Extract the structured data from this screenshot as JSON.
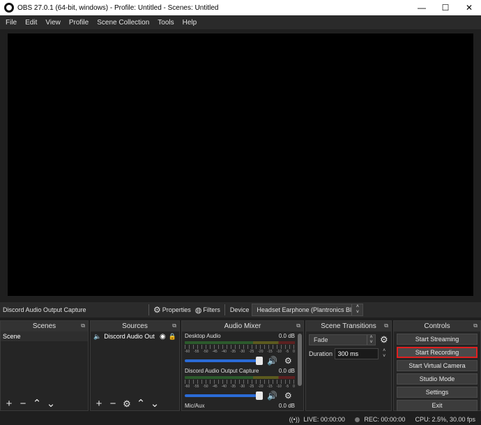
{
  "window": {
    "title": "OBS 27.0.1 (64-bit, windows) - Profile: Untitled - Scenes: Untitled",
    "minimize_glyph": "—",
    "maximize_glyph": "☐",
    "close_glyph": "✕"
  },
  "menu": [
    "File",
    "Edit",
    "View",
    "Profile",
    "Scene Collection",
    "Tools",
    "Help"
  ],
  "context_bar": {
    "source_name": "Discord Audio Output Capture",
    "properties_label": "Properties",
    "filters_label": "Filters",
    "device_label": "Device",
    "device_value": "Headset Earphone (Plantronics Blac"
  },
  "docks": {
    "scenes": {
      "title": "Scenes",
      "items": [
        "Scene"
      ]
    },
    "sources": {
      "title": "Sources",
      "items": [
        "Discord Audio Out"
      ]
    },
    "mixer": {
      "title": "Audio Mixer",
      "tracks": [
        {
          "name": "Desktop Audio",
          "db": "0.0 dB",
          "volume": 1.0
        },
        {
          "name": "Discord Audio Output Capture",
          "db": "0.0 dB",
          "volume": 1.0
        },
        {
          "name": "Mic/Aux",
          "db": "0.0 dB"
        }
      ],
      "tick_labels": [
        "-60",
        "-55",
        "-50",
        "-45",
        "-40",
        "-35",
        "-30",
        "-25",
        "-20",
        "-15",
        "-10",
        "-5",
        "0"
      ]
    },
    "transitions": {
      "title": "Scene Transitions",
      "transition": "Fade",
      "duration_label": "Duration",
      "duration_value": "300 ms"
    },
    "controls": {
      "title": "Controls",
      "buttons": [
        "Start Streaming",
        "Start Recording",
        "Start Virtual Camera",
        "Studio Mode",
        "Settings",
        "Exit"
      ]
    }
  },
  "status": {
    "live": "LIVE: 00:00:00",
    "rec": "REC: 00:00:00",
    "cpu": "CPU: 2.5%, 30.00 fps"
  },
  "colors": {
    "highlight": "#e02020",
    "fader": "#2b6bd6"
  }
}
